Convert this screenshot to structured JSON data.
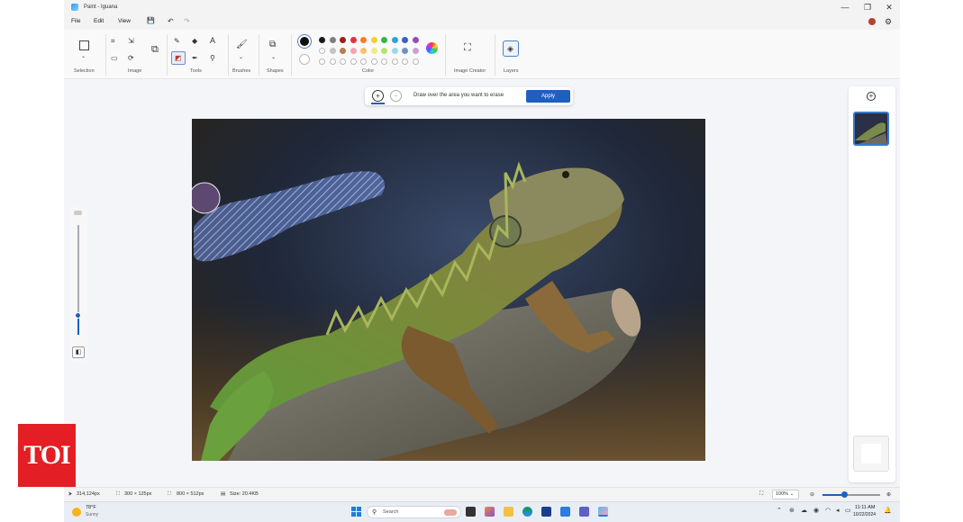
{
  "window": {
    "title": "Paint - Iguana",
    "minimize": "—",
    "restore": "❐",
    "close": "✕"
  },
  "menu": {
    "file": "File",
    "edit": "Edit",
    "view": "View"
  },
  "ribbon": {
    "selection": "Selection",
    "image": "Image",
    "tools": "Tools",
    "brushes": "Brushes",
    "shapes": "Shapes",
    "color": "Color",
    "image_creator": "Image Creator",
    "layers": "Layers",
    "colors_row1": [
      "#1a1a1a",
      "#7f7f7f",
      "#a31d1d",
      "#e5313f",
      "#f57d24",
      "#f8d12f",
      "#3cb34a",
      "#2aa4d8",
      "#3b5fc4",
      "#9a4bb8"
    ],
    "colors_row2": [
      "#ffffff",
      "#c3c3c3",
      "#b97a57",
      "#f6a3b3",
      "#f8c06c",
      "#f1e88b",
      "#b5e36a",
      "#99d9ea",
      "#7092be",
      "#c8a2d6"
    ]
  },
  "erase_bar": {
    "hint": "Draw over the area you want to erase",
    "apply": "Apply"
  },
  "status": {
    "cursor": "314,124px",
    "selection": "300 × 125px",
    "canvas": "800 × 512px",
    "size": "Size: 20.4KB",
    "zoom": "100%"
  },
  "taskbar": {
    "temp": "78°F",
    "weather": "Sunny",
    "search": "Search",
    "time": "11:11 AM",
    "date": "10/22/2024"
  },
  "watermark": "TOI"
}
